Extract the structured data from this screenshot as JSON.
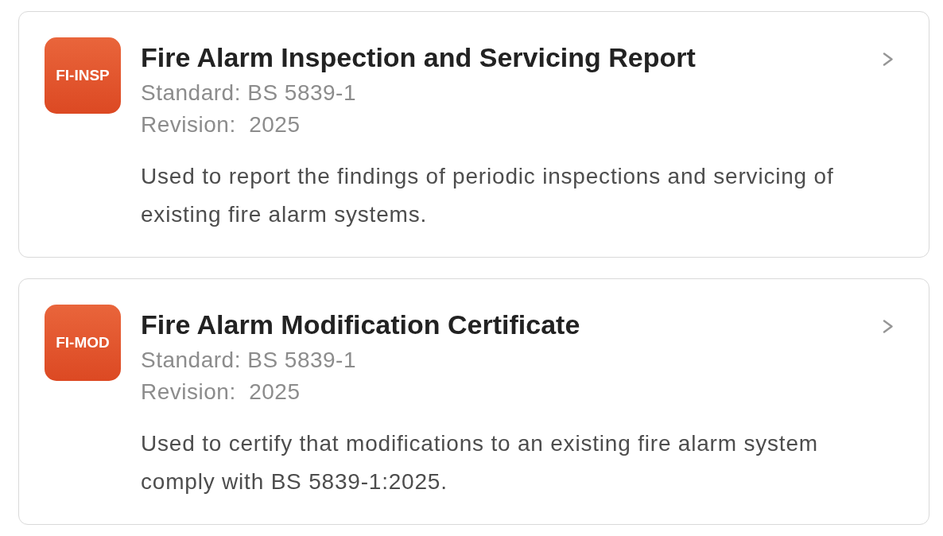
{
  "forms": [
    {
      "code": "FI-INSP",
      "title": "Fire Alarm Inspection and Servicing Report",
      "standard": "Standard: BS 5839-1",
      "revision": "Revision:  2025",
      "description": "Used to report the findings of periodic inspections and servicing of existing fire alarm systems."
    },
    {
      "code": "FI-MOD",
      "title": "Fire Alarm Modification Certificate",
      "standard": "Standard: BS 5839-1",
      "revision": "Revision:  2025",
      "description": "Used to certify that modifications to an existing fire alarm system comply with BS 5839-1:2025."
    }
  ]
}
